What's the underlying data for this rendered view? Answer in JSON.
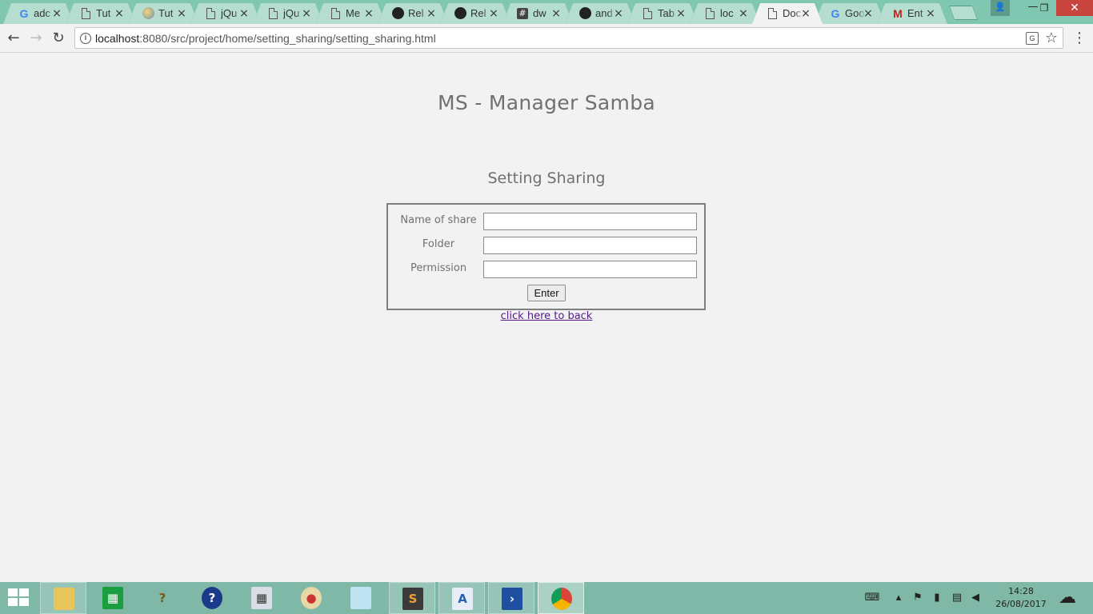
{
  "browser": {
    "tabs": [
      {
        "favicon": "google-icon",
        "title": "adc",
        "close": "×"
      },
      {
        "favicon": "document-icon",
        "title": "Tut",
        "close": "×"
      },
      {
        "favicon": "globe-icon",
        "title": "Tut",
        "close": "×"
      },
      {
        "favicon": "document-icon",
        "title": "jQu",
        "close": "×"
      },
      {
        "favicon": "document-icon",
        "title": "jQu",
        "close": "×"
      },
      {
        "favicon": "document-icon",
        "title": "Me",
        "close": "×"
      },
      {
        "favicon": "github-icon",
        "title": "Rel",
        "close": "×"
      },
      {
        "favicon": "github-icon",
        "title": "Rel",
        "close": "×"
      },
      {
        "favicon": "hash-icon",
        "title": "dw",
        "close": "×"
      },
      {
        "favicon": "github-icon",
        "title": "and",
        "close": "×"
      },
      {
        "favicon": "document-icon",
        "title": "Tab",
        "close": "×"
      },
      {
        "favicon": "document-icon",
        "title": "loc",
        "close": "×"
      },
      {
        "favicon": "document-icon",
        "title": "Doc",
        "close": "×",
        "active": true
      },
      {
        "favicon": "google-icon",
        "title": "Goo",
        "close": "×"
      },
      {
        "favicon": "gmail-icon",
        "title": "Ent",
        "close": "×"
      }
    ],
    "url_host": "localhost",
    "url_rest": ":8080/src/project/home/setting_sharing/setting_sharing.html"
  },
  "page": {
    "site_title": "MS - Manager Samba",
    "section_title": "Setting Sharing",
    "form": {
      "fields": [
        {
          "label": "Name of share",
          "value": ""
        },
        {
          "label": "Folder",
          "value": ""
        },
        {
          "label": "Permission",
          "value": ""
        }
      ],
      "submit_label": "Enter"
    },
    "back_link": "click here to back"
  },
  "taskbar": {
    "clock_time": "14:28",
    "clock_date": "26/08/2017"
  },
  "colors": {
    "tabstrip": "#7fc7b1",
    "page_bg": "#f2f2f2",
    "heading": "#707070",
    "visited_link": "#551a8b"
  }
}
